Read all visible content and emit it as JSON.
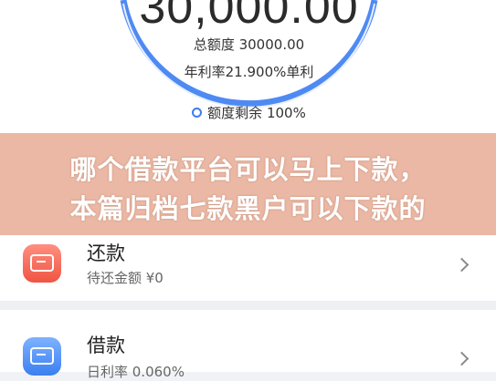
{
  "credit": {
    "amount": "30,000.00",
    "total_limit": "总额度 30000.00",
    "annual_rate": "年利率21.900%单利",
    "remaining": "额度剩余 100%"
  },
  "banner": {
    "line1": "哪个借款平台可以马上下款，",
    "line2": "本篇归档七款黑户可以下款的"
  },
  "menu": {
    "repay": {
      "title": "还款",
      "subtitle": "待还金额 ¥0"
    },
    "borrow": {
      "title": "借款",
      "subtitle": "日利率 0.060%"
    }
  },
  "colors": {
    "ring": "#3c7df2",
    "repay_icon": "#f05442",
    "borrow_icon": "#3a7ff1",
    "banner": "#eab8a4"
  }
}
